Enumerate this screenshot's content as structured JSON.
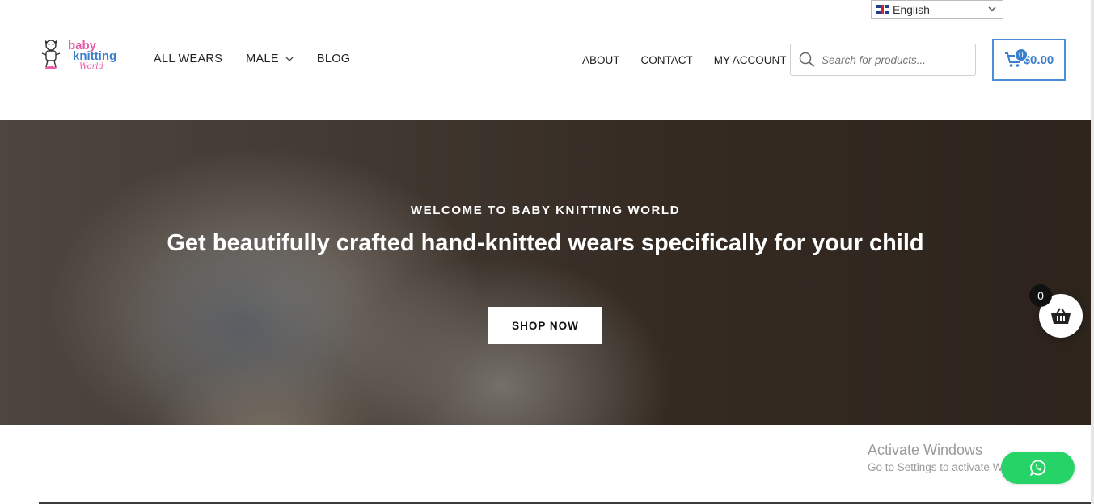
{
  "language_selector": {
    "value": "English",
    "flag_icon": "uk-flag-icon"
  },
  "logo": {
    "line1": "baby",
    "line2": "knitting",
    "line3": "World"
  },
  "nav_left": [
    {
      "label": "ALL WEARS"
    },
    {
      "label": "MALE",
      "has_dropdown": true
    },
    {
      "label": "BLOG"
    }
  ],
  "nav_right": [
    {
      "label": "ABOUT"
    },
    {
      "label": "CONTACT"
    },
    {
      "label": "MY ACCOUNT"
    }
  ],
  "search": {
    "placeholder": "Search for products..."
  },
  "header_cart": {
    "count": "0",
    "total": "$0.00",
    "accent": "#3b7fcc"
  },
  "hero": {
    "eyebrow": "WELCOME TO BABY KNITTING WORLD",
    "title": "Get beautifully crafted hand-knitted wears specifically for your child",
    "button_label": "SHOP NOW"
  },
  "floating_cart": {
    "count": "0"
  },
  "windows_watermark": {
    "title": "Activate Windows",
    "subtitle": "Go to Settings to activate Windows."
  },
  "whatsapp": {
    "color": "#25d366",
    "icon": "whatsapp-icon"
  }
}
